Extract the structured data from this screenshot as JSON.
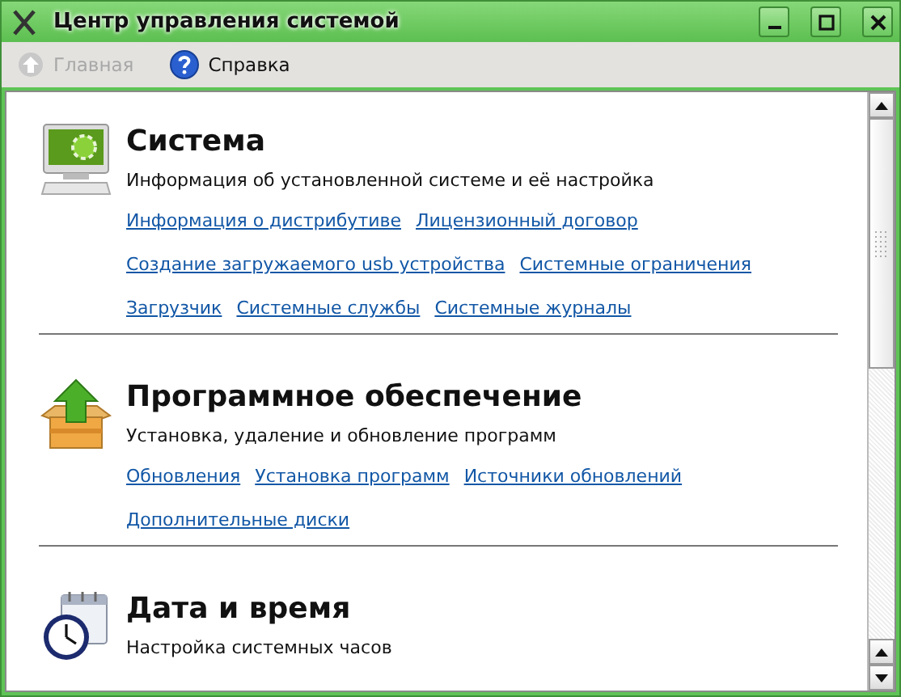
{
  "window": {
    "title": "Центр управления системой"
  },
  "toolbar": [
    {
      "kind": "home",
      "label": "Главная",
      "disabled": true
    },
    {
      "kind": "help",
      "label": "Справка",
      "disabled": false
    }
  ],
  "sections": [
    {
      "kind": "system",
      "title": "Система",
      "description": "Информация об установленной системе и её настройка",
      "link_rows": [
        [
          "Информация о дистрибутиве",
          "Лицензионный договор"
        ],
        [
          "Создание загружаемого usb устройства",
          "Системные ограничения"
        ],
        [
          "Загрузчик",
          "Системные службы",
          "Системные журналы"
        ]
      ]
    },
    {
      "kind": "software",
      "title": "Программное обеспечение",
      "description": "Установка, удаление и обновление программ",
      "link_rows": [
        [
          "Обновления",
          "Установка программ",
          "Источники обновлений"
        ],
        [
          "Дополнительные диски"
        ]
      ]
    },
    {
      "kind": "datetime",
      "title": "Дата и время",
      "description": "Настройка системных часов"
    }
  ]
}
